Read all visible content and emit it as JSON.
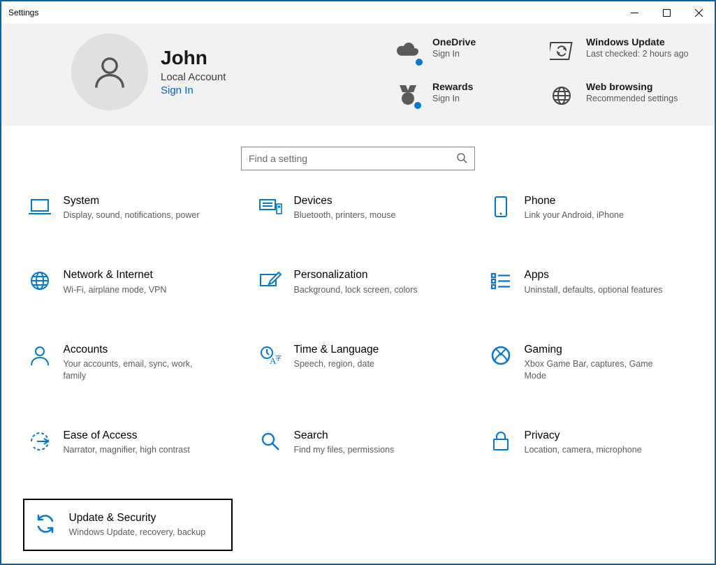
{
  "window": {
    "title": "Settings"
  },
  "header": {
    "user": {
      "name": "John",
      "account_type": "Local Account",
      "signin_label": "Sign In"
    },
    "tiles": [
      {
        "key": "onedrive",
        "title": "OneDrive",
        "subtitle": "Sign In",
        "icon": "cloud"
      },
      {
        "key": "windows-update",
        "title": "Windows Update",
        "subtitle": "Last checked: 2 hours ago",
        "icon": "sync-box"
      },
      {
        "key": "rewards",
        "title": "Rewards",
        "subtitle": "Sign In",
        "icon": "medal"
      },
      {
        "key": "web-browsing",
        "title": "Web browsing",
        "subtitle": "Recommended settings",
        "icon": "globe"
      }
    ]
  },
  "search": {
    "placeholder": "Find a setting"
  },
  "categories": [
    {
      "key": "system",
      "title": "System",
      "desc": "Display, sound, notifications, power",
      "icon": "laptop"
    },
    {
      "key": "devices",
      "title": "Devices",
      "desc": "Bluetooth, printers, mouse",
      "icon": "keyboard"
    },
    {
      "key": "phone",
      "title": "Phone",
      "desc": "Link your Android, iPhone",
      "icon": "phone"
    },
    {
      "key": "network",
      "title": "Network & Internet",
      "desc": "Wi-Fi, airplane mode, VPN",
      "icon": "globe"
    },
    {
      "key": "personalization",
      "title": "Personalization",
      "desc": "Background, lock screen, colors",
      "icon": "pen"
    },
    {
      "key": "apps",
      "title": "Apps",
      "desc": "Uninstall, defaults, optional features",
      "icon": "list"
    },
    {
      "key": "accounts",
      "title": "Accounts",
      "desc": "Your accounts, email, sync, work, family",
      "icon": "person"
    },
    {
      "key": "time-language",
      "title": "Time & Language",
      "desc": "Speech, region, date",
      "icon": "time-lang"
    },
    {
      "key": "gaming",
      "title": "Gaming",
      "desc": "Xbox Game Bar, captures, Game Mode",
      "icon": "xbox"
    },
    {
      "key": "ease-of-access",
      "title": "Ease of Access",
      "desc": "Narrator, magnifier, high contrast",
      "icon": "ease"
    },
    {
      "key": "search",
      "title": "Search",
      "desc": "Find my files, permissions",
      "icon": "magnifier"
    },
    {
      "key": "privacy",
      "title": "Privacy",
      "desc": "Location, camera, microphone",
      "icon": "lock"
    },
    {
      "key": "update-security",
      "title": "Update & Security",
      "desc": "Windows Update, recovery, backup",
      "icon": "sync",
      "highlighted": true
    }
  ],
  "colors": {
    "accent": "#0078d4",
    "link": "#0066cc"
  }
}
